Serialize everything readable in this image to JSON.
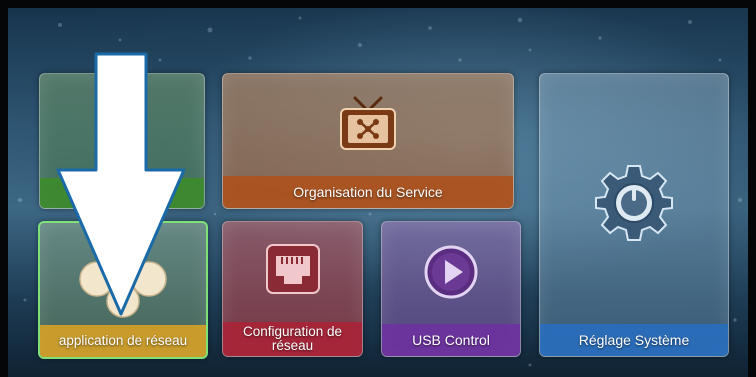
{
  "menu": {
    "tiles": [
      {
        "id": "tile-green",
        "label": ""
      },
      {
        "id": "tile-org",
        "label": "Organisation du Service"
      },
      {
        "id": "tile-app",
        "label": "application de réseau"
      },
      {
        "id": "tile-config",
        "label": "Configuration de réseau"
      },
      {
        "id": "tile-usb",
        "label": "USB Control"
      },
      {
        "id": "tile-sys",
        "label": "Réglage Système"
      }
    ],
    "selected": "application de réseau"
  },
  "icons": {
    "tv": "tv-network-icon",
    "clover": "clover-icon",
    "ethernet": "ethernet-port-icon",
    "play": "play-icon",
    "gear": "gear-icon",
    "arrow": "down-arrow-overlay"
  },
  "colors": {
    "selection_border": "#7fe07a",
    "org_label_bg": "#af5019",
    "app_label_bg": "#d2a028",
    "config_label_bg": "#aa2337",
    "usb_label_bg": "#6e32a0",
    "sys_label_bg": "#286ebe"
  }
}
